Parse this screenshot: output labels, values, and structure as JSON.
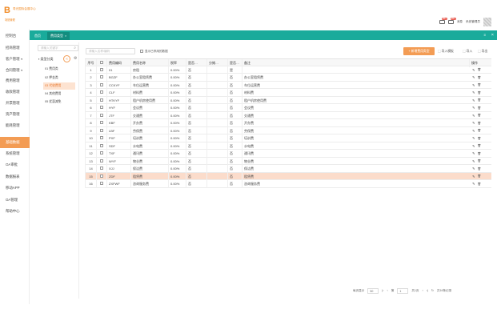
{
  "app": {
    "logo_mark": "B",
    "logo_text": "寿光国际会展中心",
    "logo_sub": "场馆管理"
  },
  "header": {
    "mail_badge": "99+",
    "msg_badge": "99+",
    "msg_label": "消息",
    "user_label": "系统管理员"
  },
  "sidebar": {
    "items": [
      {
        "label": "控制台"
      },
      {
        "label": "招商管理"
      },
      {
        "label": "客户管理",
        "arrow": "▼"
      },
      {
        "label": "合同管理",
        "arrow": "▼"
      },
      {
        "label": "费用管理"
      },
      {
        "label": "收款管理"
      },
      {
        "label": "开票管理"
      },
      {
        "label": "资产管理"
      },
      {
        "label": "能耗管理"
      },
      {
        "label": "基础数据"
      },
      {
        "label": "系统管理"
      },
      {
        "label": "OA审批"
      },
      {
        "label": "数据报表"
      },
      {
        "label": "移动APP"
      },
      {
        "label": "OA管理"
      },
      {
        "label": "帮助中心"
      }
    ]
  },
  "tabs": [
    {
      "label": "首页"
    },
    {
      "label": "费用类型",
      "close": "×"
    }
  ],
  "tabbar": {
    "menu": "≡",
    "close": "×"
  },
  "tree": {
    "search_placeholder": "请输入关键字",
    "root": "类型分类",
    "collapse": "«",
    "nodes": [
      {
        "label": "01 费用类"
      },
      {
        "label": "02 押金类"
      },
      {
        "label": "03 代收费用"
      },
      {
        "label": "04 其他费用"
      },
      {
        "label": "05 优惠减免"
      }
    ]
  },
  "toolbar": {
    "search_placeholder": "请输入名称/编码",
    "include_disabled": "显示已停用的数据",
    "add_label": "+ 新增费用类型",
    "import_label": "导入模板",
    "export_label": "导入",
    "print_label": "导出"
  },
  "table": {
    "columns": [
      "序号",
      "",
      "费用编码",
      "费用名称",
      "税率",
      "是否…",
      "分摊…",
      "是否…",
      "备注",
      "操作"
    ],
    "rows": [
      {
        "idx": "1",
        "code": "01",
        "name": "房租",
        "rate": "0.00%",
        "c1": "否",
        "c2": "",
        "c3": "是",
        "note": ""
      },
      {
        "idx": "2",
        "code": "BGZF",
        "name": "办公室租赁费",
        "rate": "0.00%",
        "c1": "否",
        "c2": "",
        "c3": "否",
        "note": "办公室租赁费"
      },
      {
        "idx": "3",
        "code": "CCKYF",
        "name": "车位运营费",
        "rate": "0.00%",
        "c1": "否",
        "c2": "",
        "c3": "否",
        "note": "车位运营费"
      },
      {
        "idx": "4",
        "code": "CLF",
        "name": "材料费",
        "rate": "0.00%",
        "c1": "否",
        "c2": "",
        "c3": "否",
        "note": "材料费"
      },
      {
        "idx": "5",
        "code": "HTKYF",
        "name": "租户机房使用费",
        "rate": "0.00%",
        "c1": "否",
        "c2": "",
        "c3": "否",
        "note": "租户机房使用费"
      },
      {
        "idx": "6",
        "code": "HYF",
        "name": "会议费",
        "rate": "0.00%",
        "c1": "否",
        "c2": "",
        "c3": "否",
        "note": "会议费"
      },
      {
        "idx": "7",
        "code": "JTF",
        "name": "交通费",
        "rate": "0.00%",
        "c1": "否",
        "c2": "",
        "c3": "否",
        "note": "交通费"
      },
      {
        "idx": "8",
        "code": "KBF",
        "name": "开办费",
        "rate": "0.00%",
        "c1": "否",
        "c2": "",
        "c3": "否",
        "note": "开办费"
      },
      {
        "idx": "9",
        "code": "LBF",
        "name": "劳保费",
        "rate": "0.00%",
        "c1": "否",
        "c2": "",
        "c3": "否",
        "note": "劳保费"
      },
      {
        "idx": "10",
        "code": "PXF",
        "name": "培训费",
        "rate": "0.00%",
        "c1": "否",
        "c2": "",
        "c3": "否",
        "note": "培训费"
      },
      {
        "idx": "11",
        "code": "SDF",
        "name": "水电费",
        "rate": "0.00%",
        "c1": "否",
        "c2": "",
        "c3": "否",
        "note": "水电费"
      },
      {
        "idx": "12",
        "code": "TXF",
        "name": "通讯费",
        "rate": "0.00%",
        "c1": "否",
        "c2": "",
        "c3": "否",
        "note": "通讯费"
      },
      {
        "idx": "13",
        "code": "WYF",
        "name": "物业费",
        "rate": "0.00%",
        "c1": "否",
        "c2": "",
        "c3": "否",
        "note": "物业费"
      },
      {
        "idx": "14",
        "code": "XJJ",
        "name": "保洁费",
        "rate": "0.00%",
        "c1": "否",
        "c2": "",
        "c3": "否",
        "note": "保洁费"
      },
      {
        "idx": "15",
        "code": "ZDF",
        "name": "租赁费",
        "rate": "0.00%",
        "c1": "否",
        "c2": "",
        "c3": "否",
        "note": "租赁费",
        "highlight": true
      },
      {
        "idx": "16",
        "code": "ZXFWF",
        "name": "咨询服务费",
        "rate": "0.00%",
        "c1": "否",
        "c2": "",
        "c3": "否",
        "note": "咨询服务费"
      }
    ],
    "edit_icon": "✎",
    "delete_icon": "🗑"
  },
  "pager": {
    "size_label": "每页显示",
    "size": "50",
    "prev_first": "|‹",
    "prev": "‹",
    "page_label": "第",
    "page": "1",
    "of": "共1页",
    "next": "›",
    "next_last": "›|",
    "refresh": "↻",
    "summary": "共16条记录"
  },
  "colors": {
    "teal": "#1aab9b",
    "orange": "#f39c54",
    "highlight": "#fbdccb"
  }
}
